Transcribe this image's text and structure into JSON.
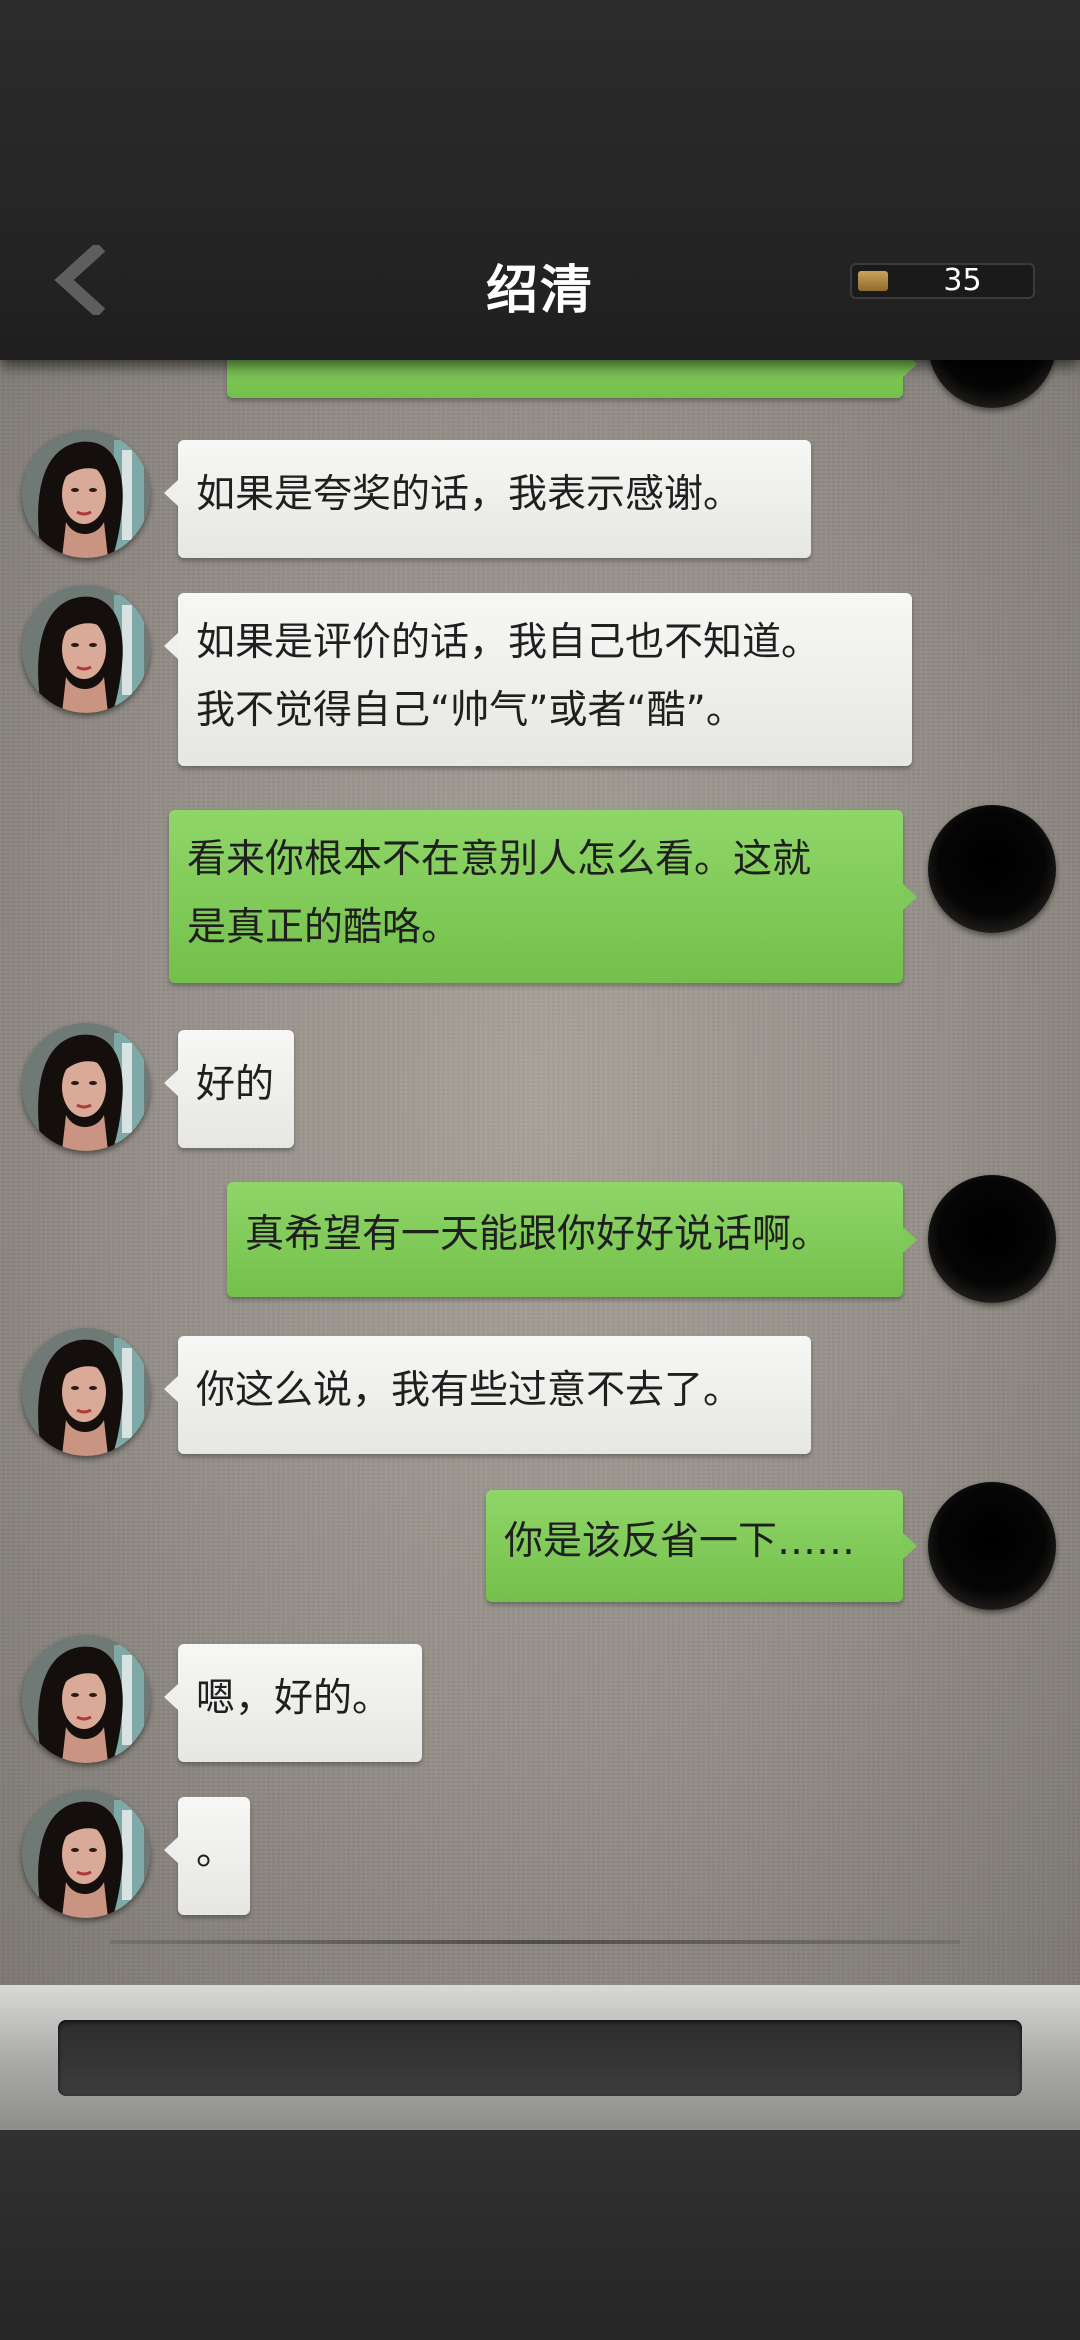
{
  "header": {
    "title": "绍清",
    "counter_value": "35",
    "back_icon": "chevron-left-icon"
  },
  "messages": [
    {
      "sender": "her",
      "lines": [
        "如果是夸奖的话，我表示感谢。"
      ]
    },
    {
      "sender": "her",
      "lines": [
        "如果是评价的话，我自己也不知道。",
        "我不觉得自己“帅气”或者“酷”。"
      ]
    },
    {
      "sender": "me",
      "lines": [
        "看来你根本不在意别人怎么看。这就",
        "是真正的酷咯。"
      ]
    },
    {
      "sender": "her",
      "lines": [
        "好的"
      ]
    },
    {
      "sender": "me",
      "lines": [
        "真希望有一天能跟你好好说话啊。"
      ]
    },
    {
      "sender": "her",
      "lines": [
        "你这么说，我有些过意不去了。"
      ]
    },
    {
      "sender": "me",
      "lines": [
        "你是该反省一下……"
      ]
    },
    {
      "sender": "her",
      "lines": [
        "嗯，好的。"
      ]
    },
    {
      "sender": "her",
      "lines": [
        "。"
      ]
    }
  ],
  "colors": {
    "outgoing_bubble": "#7ec957",
    "incoming_bubble": "#efefed",
    "header_bg": "#262626"
  }
}
